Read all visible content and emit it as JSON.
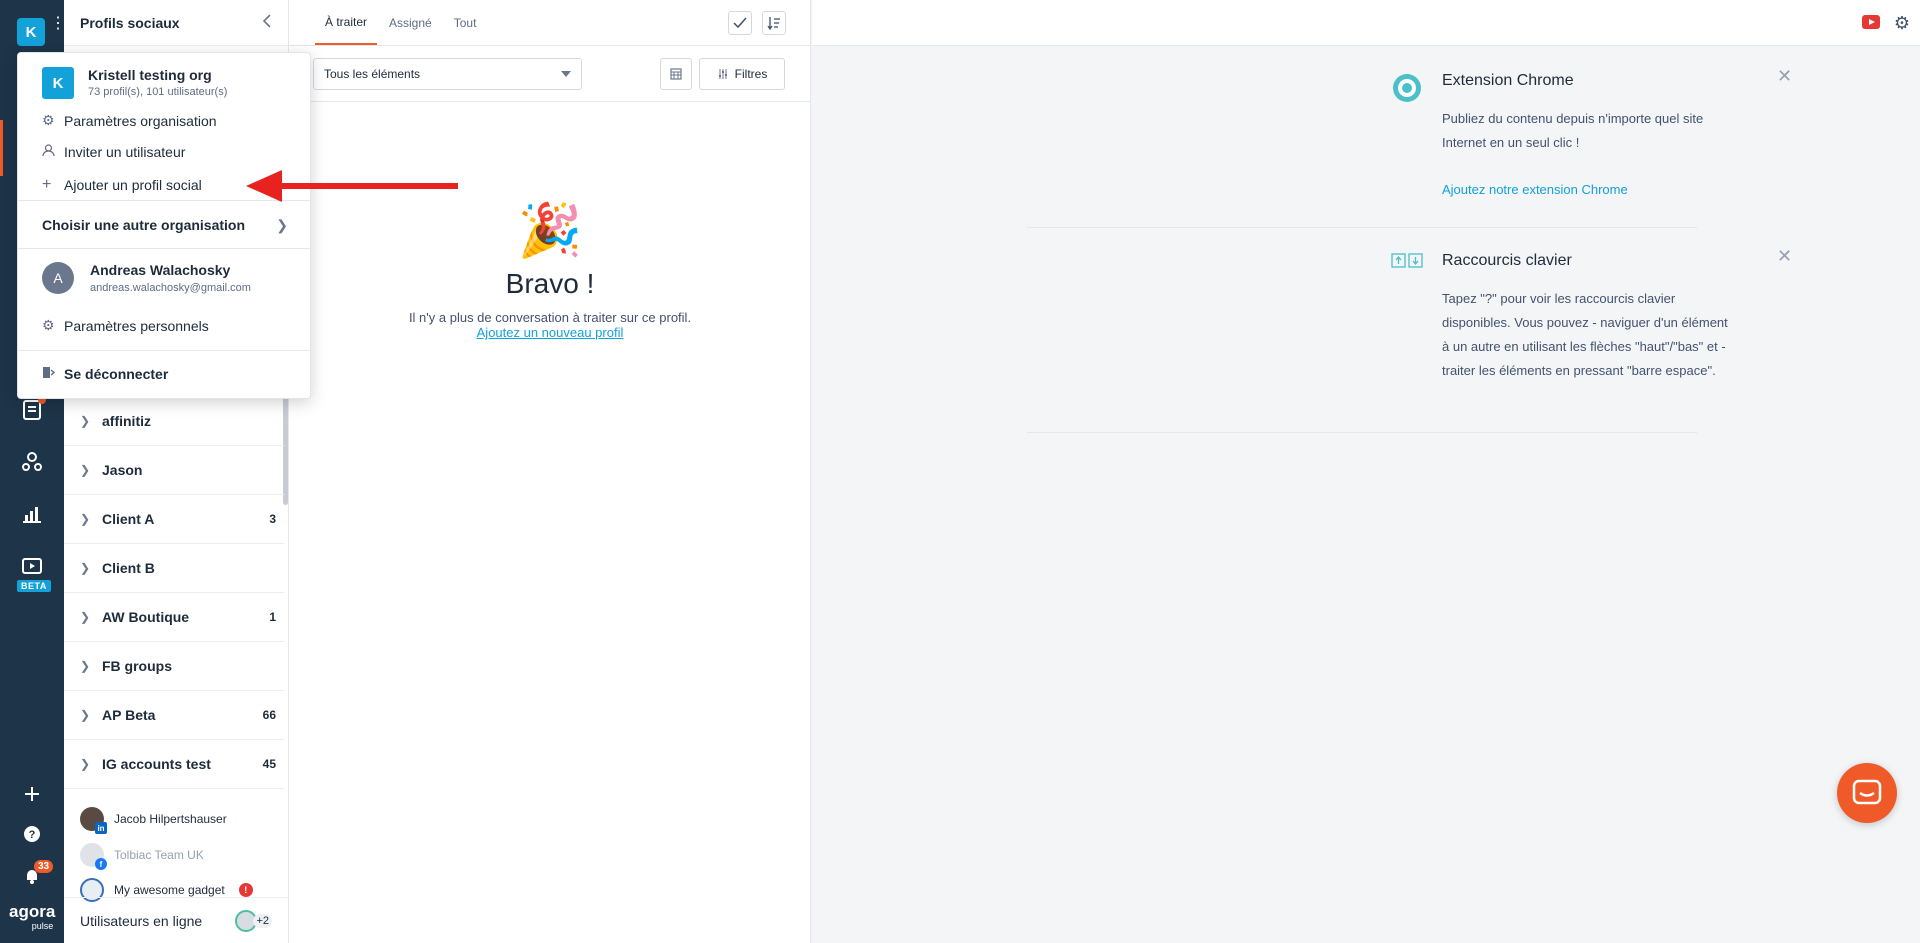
{
  "rail": {
    "org_initial": "K",
    "beta_label": "BETA",
    "notifications_count": "33",
    "logo_top": "agora",
    "logo_bottom": "pulse"
  },
  "profiles": {
    "title": "Profils sociaux",
    "groups": [
      {
        "name": "affinitiz",
        "count": ""
      },
      {
        "name": "Jason",
        "count": ""
      },
      {
        "name": "Client A",
        "count": "3"
      },
      {
        "name": "Client B",
        "count": ""
      },
      {
        "name": "AW Boutique",
        "count": "1"
      },
      {
        "name": "FB groups",
        "count": ""
      },
      {
        "name": "AP Beta",
        "count": "66"
      },
      {
        "name": "IG accounts test",
        "count": "45"
      }
    ],
    "items": [
      {
        "name": "Jacob Hilpertshauser"
      },
      {
        "name": "Tolbiac Team UK"
      },
      {
        "name": "My awesome gadget",
        "error": "!"
      }
    ],
    "online_label": "Utilisateurs en ligne",
    "online_more": "+2"
  },
  "inbox": {
    "tabs": [
      "À traiter",
      "Assigné",
      "Tout"
    ],
    "select_value": "Tous les éléments",
    "filters_label": "Filtres",
    "empty_title": "Bravo !",
    "empty_message": "Il n'y a plus de conversation à traiter sur ce profil.",
    "empty_link": "Ajoutez un nouveau profil"
  },
  "tips": {
    "chrome": {
      "title": "Extension Chrome",
      "body": "Publiez du contenu depuis n'importe quel site Internet en un seul clic !",
      "link": "Ajoutez notre extension Chrome"
    },
    "shortcuts": {
      "title": "Raccourcis clavier",
      "body": "Tapez \"?\" pour voir les raccourcis clavier disponibles. Vous pouvez - naviguer d'un élément à un autre en utilisant les flèches \"haut\"/\"bas\" et - traiter les éléments en pressant \"barre espace\"."
    }
  },
  "menu": {
    "org_initial": "K",
    "org_name": "Kristell testing org",
    "org_sub": "73 profil(s), 101 utilisateur(s)",
    "org_settings": "Paramètres organisation",
    "invite": "Inviter un utilisateur",
    "add_profile": "Ajouter un profil social",
    "choose_org": "Choisir une autre organisation",
    "user_initial": "A",
    "user_name": "Andreas Walachosky",
    "user_email": "andreas.walachosky@gmail.com",
    "personal_settings": "Paramètres personnels",
    "logout": "Se déconnecter"
  },
  "colors": {
    "accent": "#f05a28",
    "brand_blue": "#13a1d9",
    "rail_bg": "#1d3449",
    "annotation_arrow": "#e8231f"
  }
}
